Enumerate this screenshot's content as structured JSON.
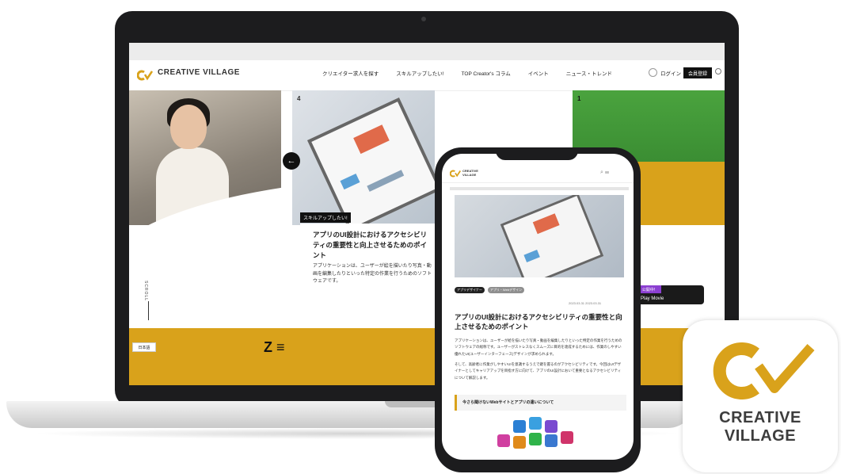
{
  "site": {
    "logo_text": "CREATIVE VILLAGE",
    "nav": [
      "クリエイター求人を探す",
      "スキルアップしたい!",
      "TOP Creator's コラム",
      "イベント",
      "ニュース・トレンド"
    ],
    "login_label": "ログイン",
    "register_label": "会員登録"
  },
  "carousel": {
    "slide_number": "4",
    "slide_tag": "スキルアップしたい!",
    "slide_title": "アプリのUI設計におけるアクセシビリティの重要性と向上させるためのポイント",
    "slide_desc": "アプリケーションは、ユーザーが絵を描いたり写真・動画を編集したりといった特定の作業を行うためのソフトウェアです。",
    "right_slide_number": "1",
    "movie_badge": "公開中!",
    "movie_label": "Play Movie",
    "prev_arrow": "←"
  },
  "side": {
    "scroll_label": "SCROLL",
    "lang_label": "日本語"
  },
  "phone": {
    "logo_line1": "CREATIVE",
    "logo_line2": "VILLAGE",
    "header_icons": "⌕ ☰",
    "tags": [
      "アプリデザイナー",
      "アプリ・Webデザイン"
    ],
    "meta": "2023.03.31   2023.03.31",
    "title": "アプリのUI設計におけるアクセシビリティの重要性と向上させるためのポイント",
    "body1": "アプリケーションは、ユーザーが絵を描いたり写真・動画を編集したりといった特定の作業を行うためのソフトウェアの総称です。ユーザーがストレスなくスムーズに目的を達成するためには、作業のしやすい優れたUI(ユーザーインターフェース)デザインが求められます。",
    "body2": "そして、高齢者に作業がしやすいUIを意識するうえで鍵を握るのがアクセシビリティです。今回はUIデザイナーとしてキャリアアップを目指す方に向けて、アプリのUI設計において重要となるアクセシビリティについて解説します。",
    "quote": "今さら聞けないWebサイトとアプリの違いについて"
  },
  "app_icon": {
    "line1": "CREATIVE",
    "line2": "VILLAGE"
  },
  "colors": {
    "brand_gold": "#d9a21b",
    "device_black": "#1c1c1e"
  }
}
